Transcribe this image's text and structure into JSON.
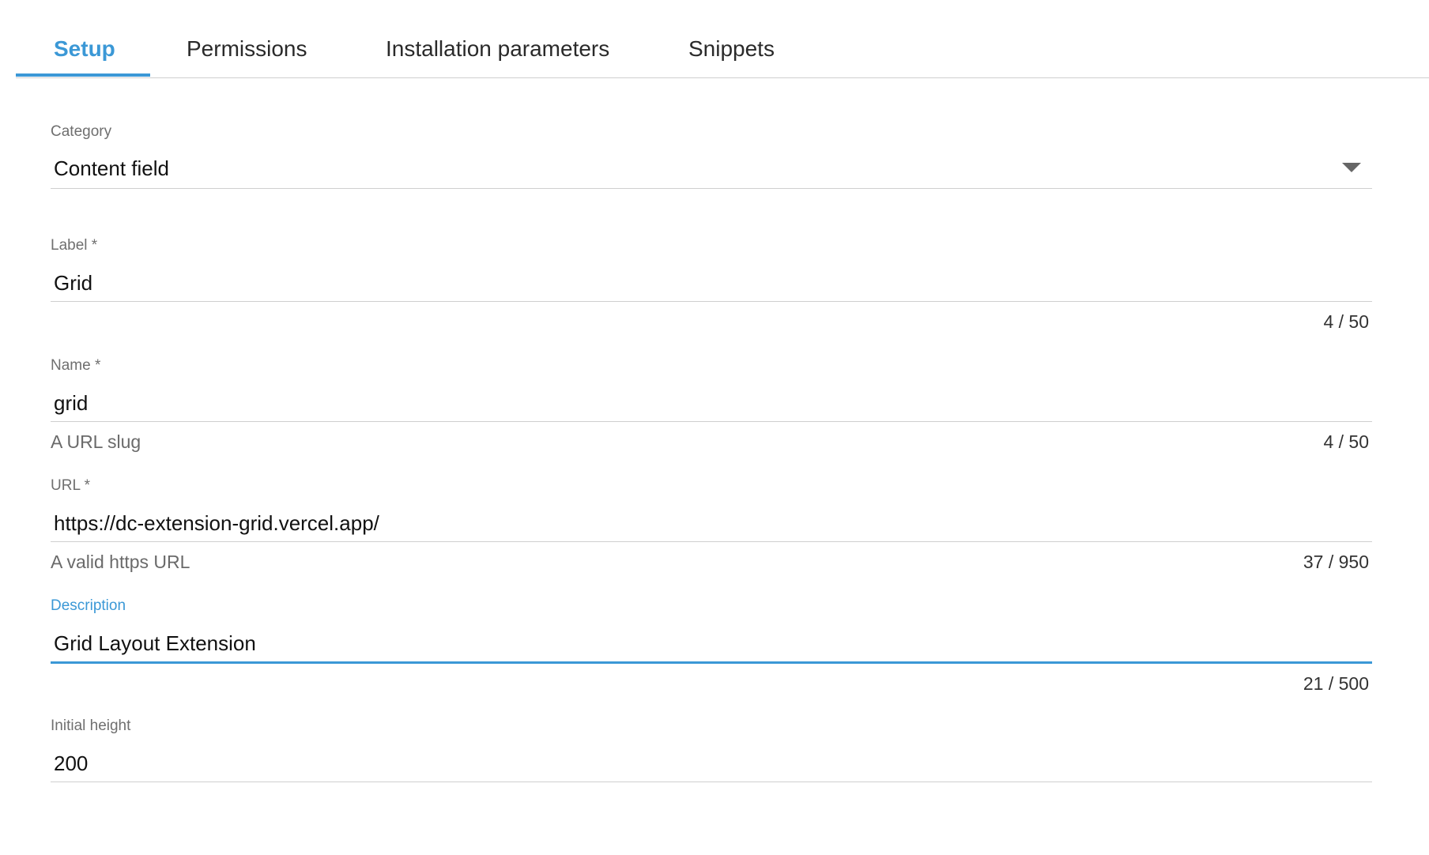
{
  "tabs": [
    {
      "label": "Setup",
      "active": true
    },
    {
      "label": "Permissions",
      "active": false
    },
    {
      "label": "Installation parameters",
      "active": false
    },
    {
      "label": "Snippets",
      "active": false
    }
  ],
  "accent_color": "#3b98d6",
  "form": {
    "category": {
      "label": "Category",
      "value": "Content field",
      "icon": "chevron-down-icon"
    },
    "label_field": {
      "label": "Label *",
      "value": "Grid",
      "counter": "4 / 50"
    },
    "name_field": {
      "label": "Name *",
      "value": "grid",
      "helper": "A URL slug",
      "counter": "4 / 50"
    },
    "url_field": {
      "label": "URL *",
      "value": "https://dc-extension-grid.vercel.app/",
      "helper": "A valid https URL",
      "counter": "37 / 950"
    },
    "description_field": {
      "label": "Description",
      "value": "Grid Layout Extension",
      "counter": "21 / 500",
      "focused": true
    },
    "initial_height_field": {
      "label": "Initial height",
      "value": "200"
    }
  }
}
